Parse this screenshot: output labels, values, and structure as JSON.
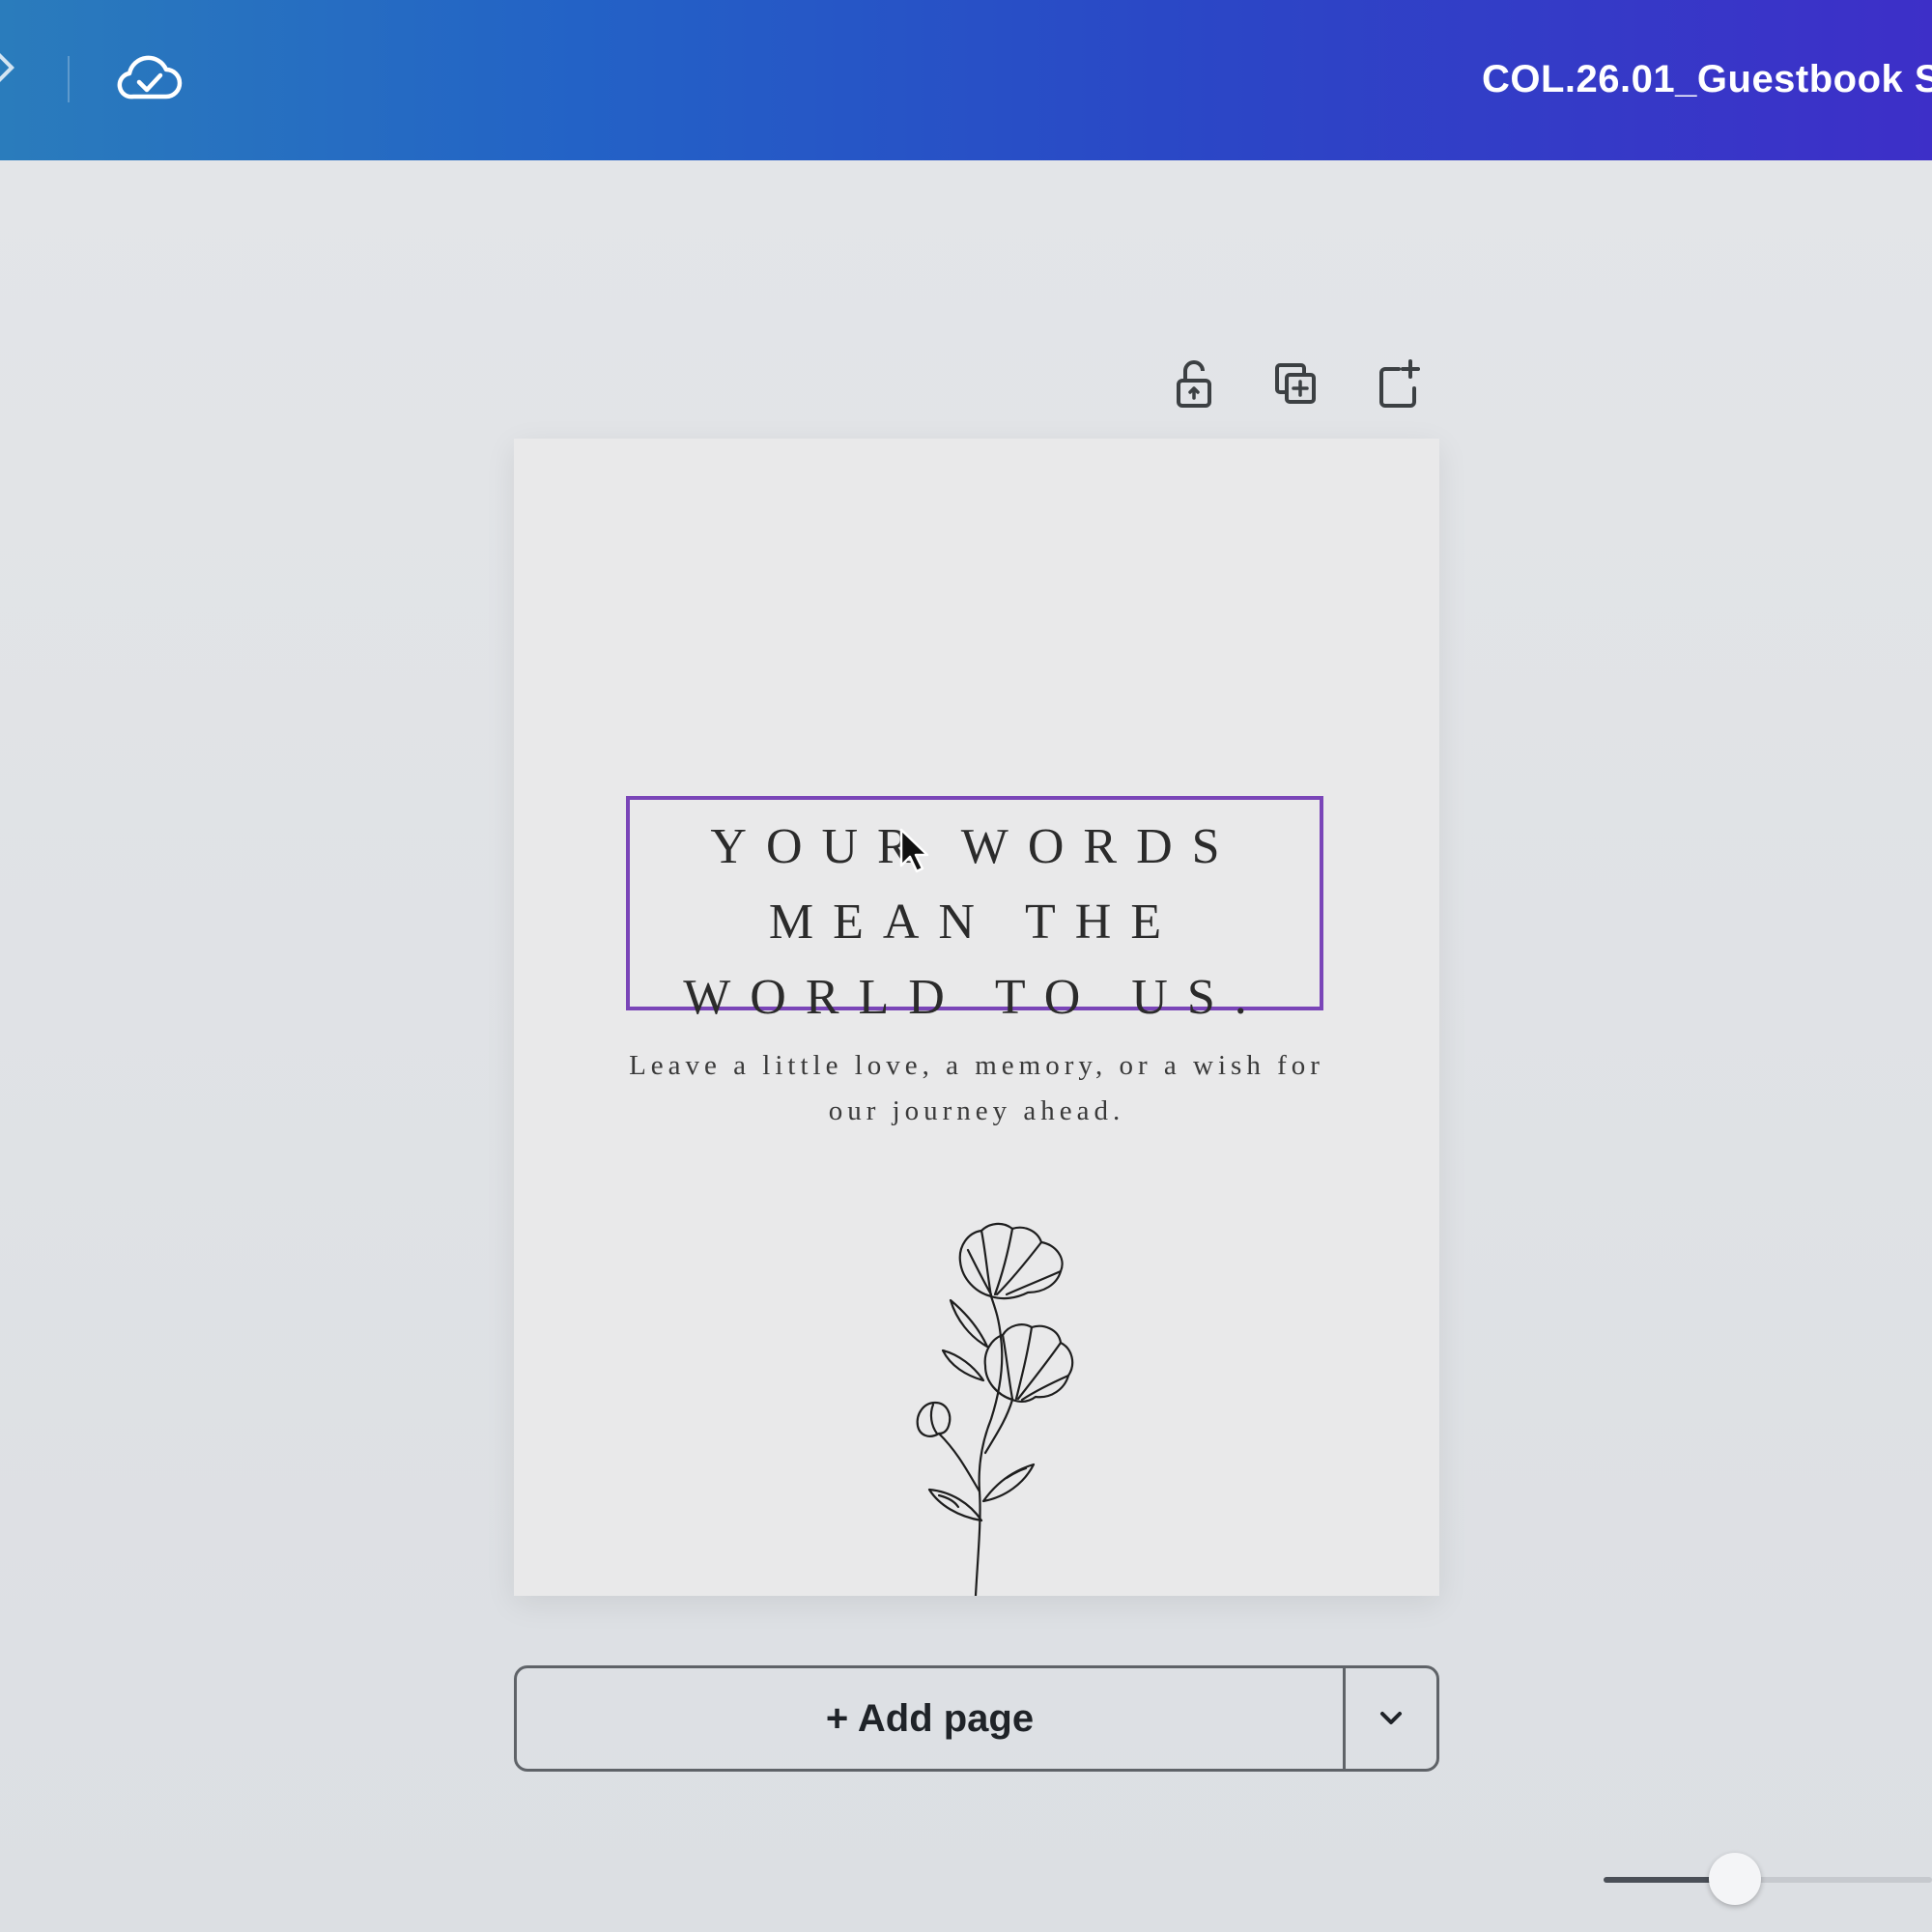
{
  "topbar": {
    "document_title": "COL.26.01_Guestbook S",
    "save_status_icon": "cloud-check-icon",
    "gradient_colors": [
      "#2a7cbc",
      "#2362c6",
      "#3d2fc8"
    ]
  },
  "page_tools": {
    "lock_icon": "unlock-icon",
    "duplicate_icon": "duplicate-page-icon",
    "add_icon": "add-page-icon"
  },
  "page": {
    "heading": "YOUR WORDS\nMEAN THE\nWORLD TO US.",
    "subtext": "Leave a little love, a memory, or a wish for our journey ahead.",
    "illustration": "flower-illustration",
    "selection_color": "#7a45b8"
  },
  "add_page": {
    "label": "+ Add page",
    "dropdown_icon": "chevron-down-icon"
  },
  "zoom": {
    "level_fraction": 0.4
  }
}
